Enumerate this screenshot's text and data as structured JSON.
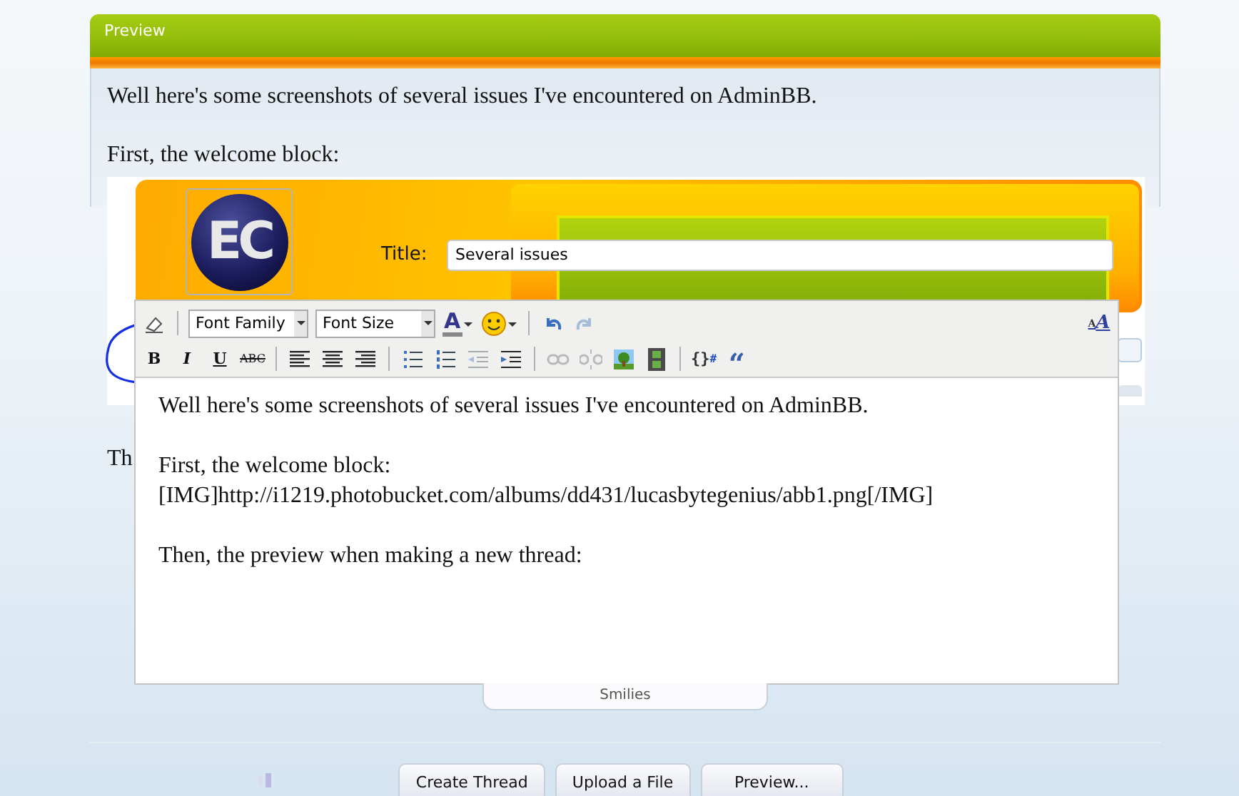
{
  "preview": {
    "title": "Preview",
    "paragraphs": [
      "Well here's some screenshots of several issues I've encountered on AdminBB.",
      "First, the welcome block:"
    ],
    "cut_text": "Th"
  },
  "welcome_image": {
    "logo": "EC",
    "title_label": "Title:",
    "title_value": "Several issues"
  },
  "editor": {
    "toolbar_rows": [
      [
        {
          "kind": "eraser"
        },
        {
          "kind": "sep"
        },
        {
          "kind": "select",
          "label": "Font Family"
        },
        {
          "kind": "select",
          "label": "Font Size"
        },
        {
          "kind": "color",
          "label": "A"
        },
        {
          "kind": "smiley"
        },
        {
          "kind": "sep"
        },
        {
          "kind": "undo",
          "disabled": false
        },
        {
          "kind": "redo",
          "disabled": true
        },
        {
          "kind": "fontsize",
          "small_label": "A",
          "label": "A"
        }
      ],
      [
        {
          "kind": "bold",
          "label": "B"
        },
        {
          "kind": "italic",
          "label": "I"
        },
        {
          "kind": "underline",
          "label": "U"
        },
        {
          "kind": "strike",
          "label": "ABC"
        },
        {
          "kind": "sep"
        },
        {
          "kind": "align-left"
        },
        {
          "kind": "align-center"
        },
        {
          "kind": "align-right"
        },
        {
          "kind": "sep"
        },
        {
          "kind": "bullets"
        },
        {
          "kind": "numbers"
        },
        {
          "kind": "outdent",
          "disabled": true
        },
        {
          "kind": "indent",
          "disabled": false
        },
        {
          "kind": "sep"
        },
        {
          "kind": "link",
          "disabled": true
        },
        {
          "kind": "unlink",
          "disabled": true
        },
        {
          "kind": "image"
        },
        {
          "kind": "film"
        },
        {
          "kind": "sep"
        },
        {
          "kind": "code",
          "label": "{}",
          "sub": "#"
        },
        {
          "kind": "quote",
          "label": "“"
        }
      ]
    ],
    "blocks": [
      [
        "Well here's some screenshots of several issues I've encountered on AdminBB."
      ],
      [
        "First, the welcome block:",
        "[IMG]http://i1219.photobucket.com/albums/dd431/lucasbytegenius/abb1.png[/IMG]"
      ],
      [
        "Then, the preview when making a new thread:"
      ]
    ],
    "tab": "Smilies"
  },
  "buttons": [
    "Create Thread",
    "Upload a File",
    "Preview..."
  ]
}
